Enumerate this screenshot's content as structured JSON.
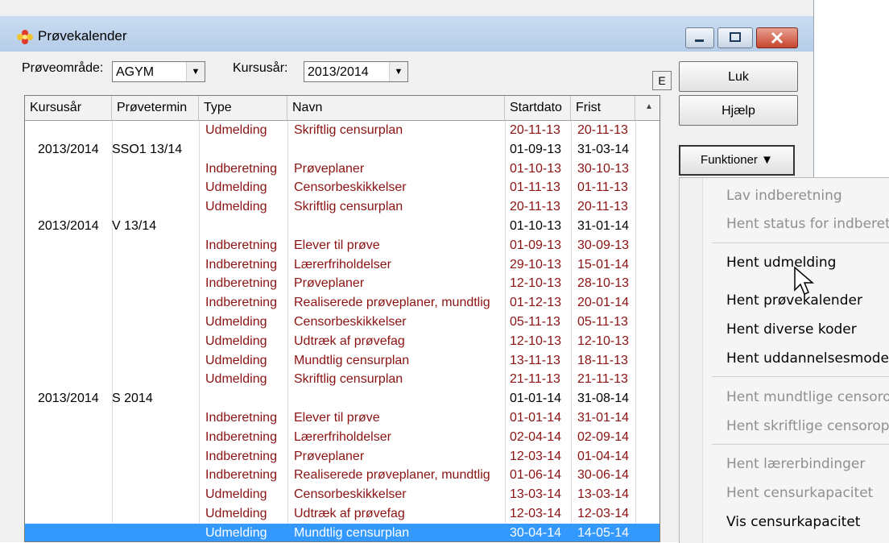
{
  "window": {
    "title": "Prøvekalender"
  },
  "toolbar": {
    "area_label": "Prøveområde:",
    "area_value": "AGYM",
    "year_label": "Kursusår:",
    "year_value": "2013/2014",
    "e_label": "E"
  },
  "columns": [
    "Kursusår",
    "Prøvetermin",
    "Type",
    "Navn",
    "Startdato",
    "Frist"
  ],
  "rows": [
    {
      "aar": "",
      "termin": "",
      "type": "Udmelding",
      "navn": "Skriftlig censurplan",
      "start": "20-11-13",
      "frist": "20-11-13"
    },
    {
      "aar": "2013/2014",
      "termin": "SSO1 13/14",
      "type": "",
      "navn": "",
      "start": "01-09-13",
      "frist": "31-03-14"
    },
    {
      "aar": "",
      "termin": "",
      "type": "Indberetning",
      "navn": "Prøveplaner",
      "start": "01-10-13",
      "frist": "30-10-13"
    },
    {
      "aar": "",
      "termin": "",
      "type": "Udmelding",
      "navn": "Censorbeskikkelser",
      "start": "01-11-13",
      "frist": "01-11-13"
    },
    {
      "aar": "",
      "termin": "",
      "type": "Udmelding",
      "navn": "Skriftlig censurplan",
      "start": "20-11-13",
      "frist": "20-11-13"
    },
    {
      "aar": "2013/2014",
      "termin": "V 13/14",
      "type": "",
      "navn": "",
      "start": "01-10-13",
      "frist": "31-01-14"
    },
    {
      "aar": "",
      "termin": "",
      "type": "Indberetning",
      "navn": "Elever til prøve",
      "start": "01-09-13",
      "frist": "30-09-13"
    },
    {
      "aar": "",
      "termin": "",
      "type": "Indberetning",
      "navn": "Lærerfriholdelser",
      "start": "29-10-13",
      "frist": "15-01-14"
    },
    {
      "aar": "",
      "termin": "",
      "type": "Indberetning",
      "navn": "Prøveplaner",
      "start": "12-10-13",
      "frist": "28-10-13"
    },
    {
      "aar": "",
      "termin": "",
      "type": "Indberetning",
      "navn": "Realiserede prøveplaner, mundtlig",
      "start": "01-12-13",
      "frist": "20-01-14"
    },
    {
      "aar": "",
      "termin": "",
      "type": "Udmelding",
      "navn": "Censorbeskikkelser",
      "start": "05-11-13",
      "frist": "05-11-13"
    },
    {
      "aar": "",
      "termin": "",
      "type": "Udmelding",
      "navn": "Udtræk af prøvefag",
      "start": "12-10-13",
      "frist": "12-10-13"
    },
    {
      "aar": "",
      "termin": "",
      "type": "Udmelding",
      "navn": "Mundtlig censurplan",
      "start": "13-11-13",
      "frist": "18-11-13"
    },
    {
      "aar": "",
      "termin": "",
      "type": "Udmelding",
      "navn": "Skriftlig censurplan",
      "start": "21-11-13",
      "frist": "21-11-13"
    },
    {
      "aar": "2013/2014",
      "termin": "S 2014",
      "type": "",
      "navn": "",
      "start": "01-01-14",
      "frist": "31-08-14"
    },
    {
      "aar": "",
      "termin": "",
      "type": "Indberetning",
      "navn": "Elever til prøve",
      "start": "01-01-14",
      "frist": "31-01-14"
    },
    {
      "aar": "",
      "termin": "",
      "type": "Indberetning",
      "navn": "Lærerfriholdelser",
      "start": "02-04-14",
      "frist": "02-09-14"
    },
    {
      "aar": "",
      "termin": "",
      "type": "Indberetning",
      "navn": "Prøveplaner",
      "start": "12-03-14",
      "frist": "01-04-14"
    },
    {
      "aar": "",
      "termin": "",
      "type": "Indberetning",
      "navn": "Realiserede prøveplaner, mundtlig",
      "start": "01-06-14",
      "frist": "30-06-14"
    },
    {
      "aar": "",
      "termin": "",
      "type": "Udmelding",
      "navn": "Censorbeskikkelser",
      "start": "13-03-14",
      "frist": "13-03-14"
    },
    {
      "aar": "",
      "termin": "",
      "type": "Udmelding",
      "navn": "Udtræk af prøvefag",
      "start": "12-03-14",
      "frist": "12-03-14"
    },
    {
      "aar": "",
      "termin": "",
      "type": "Udmelding",
      "navn": "Mundtlig censurplan",
      "start": "30-04-14",
      "frist": "14-05-14"
    }
  ],
  "buttons": {
    "luk": "Luk",
    "hjaelp": "Hjælp",
    "funktioner": "Funktioner ▼"
  },
  "menu": [
    {
      "label": "Lav indberetning",
      "enabled": false
    },
    {
      "label": "Hent status for indberetr",
      "enabled": false
    },
    {
      "label": "Hent udmelding",
      "enabled": true
    },
    {
      "label": "Hent prøvekalender",
      "enabled": true
    },
    {
      "label": "Hent diverse koder",
      "enabled": true
    },
    {
      "label": "Hent uddannelsesmodel",
      "enabled": true
    },
    {
      "label": "Hent mundtlige censoro",
      "enabled": false
    },
    {
      "label": "Hent skriftlige censoropg",
      "enabled": false
    },
    {
      "label": "Hent lærerbindinger",
      "enabled": false
    },
    {
      "label": "Hent censurkapacitet",
      "enabled": false
    },
    {
      "label": "Vis censurkapacitet",
      "enabled": true
    }
  ],
  "colors": {
    "date_red": "#8b1212",
    "selection": "#3399ff",
    "title_bar": "#c9dcf2"
  },
  "icons": {
    "app": "flower-icon",
    "pointer": "mouse-cursor-icon"
  }
}
